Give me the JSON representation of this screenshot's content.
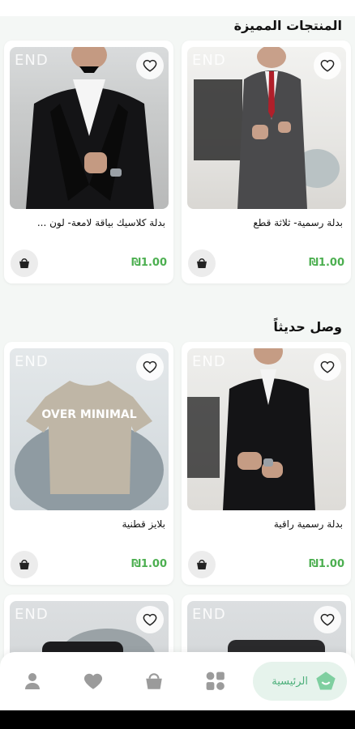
{
  "sections": {
    "featured_title": "المنتجات المميزة",
    "new_title": "وصل حديثاً"
  },
  "products": [
    {
      "name": "بدلة كلاسيك بياقة لامعة- لون ...",
      "price": "₪1.00"
    },
    {
      "name": "بدلة رسمية- ثلاثة قطع",
      "price": "₪1.00"
    },
    {
      "name": "بلايز قطنية",
      "price": "₪1.00"
    },
    {
      "name": "بدلة رسمية راقية",
      "price": "₪1.00"
    }
  ],
  "watermark": "END",
  "tshirt_print": "OVER MINIMAL",
  "nav": {
    "home_label": "الرئيسية",
    "items": [
      "user-icon",
      "heart-icon",
      "basket-icon",
      "grid-icon",
      "home-icon"
    ]
  },
  "colors": {
    "accent": "#4caf50",
    "home_bg": "#e6f3ec",
    "home_icon": "#7fcfa0"
  }
}
